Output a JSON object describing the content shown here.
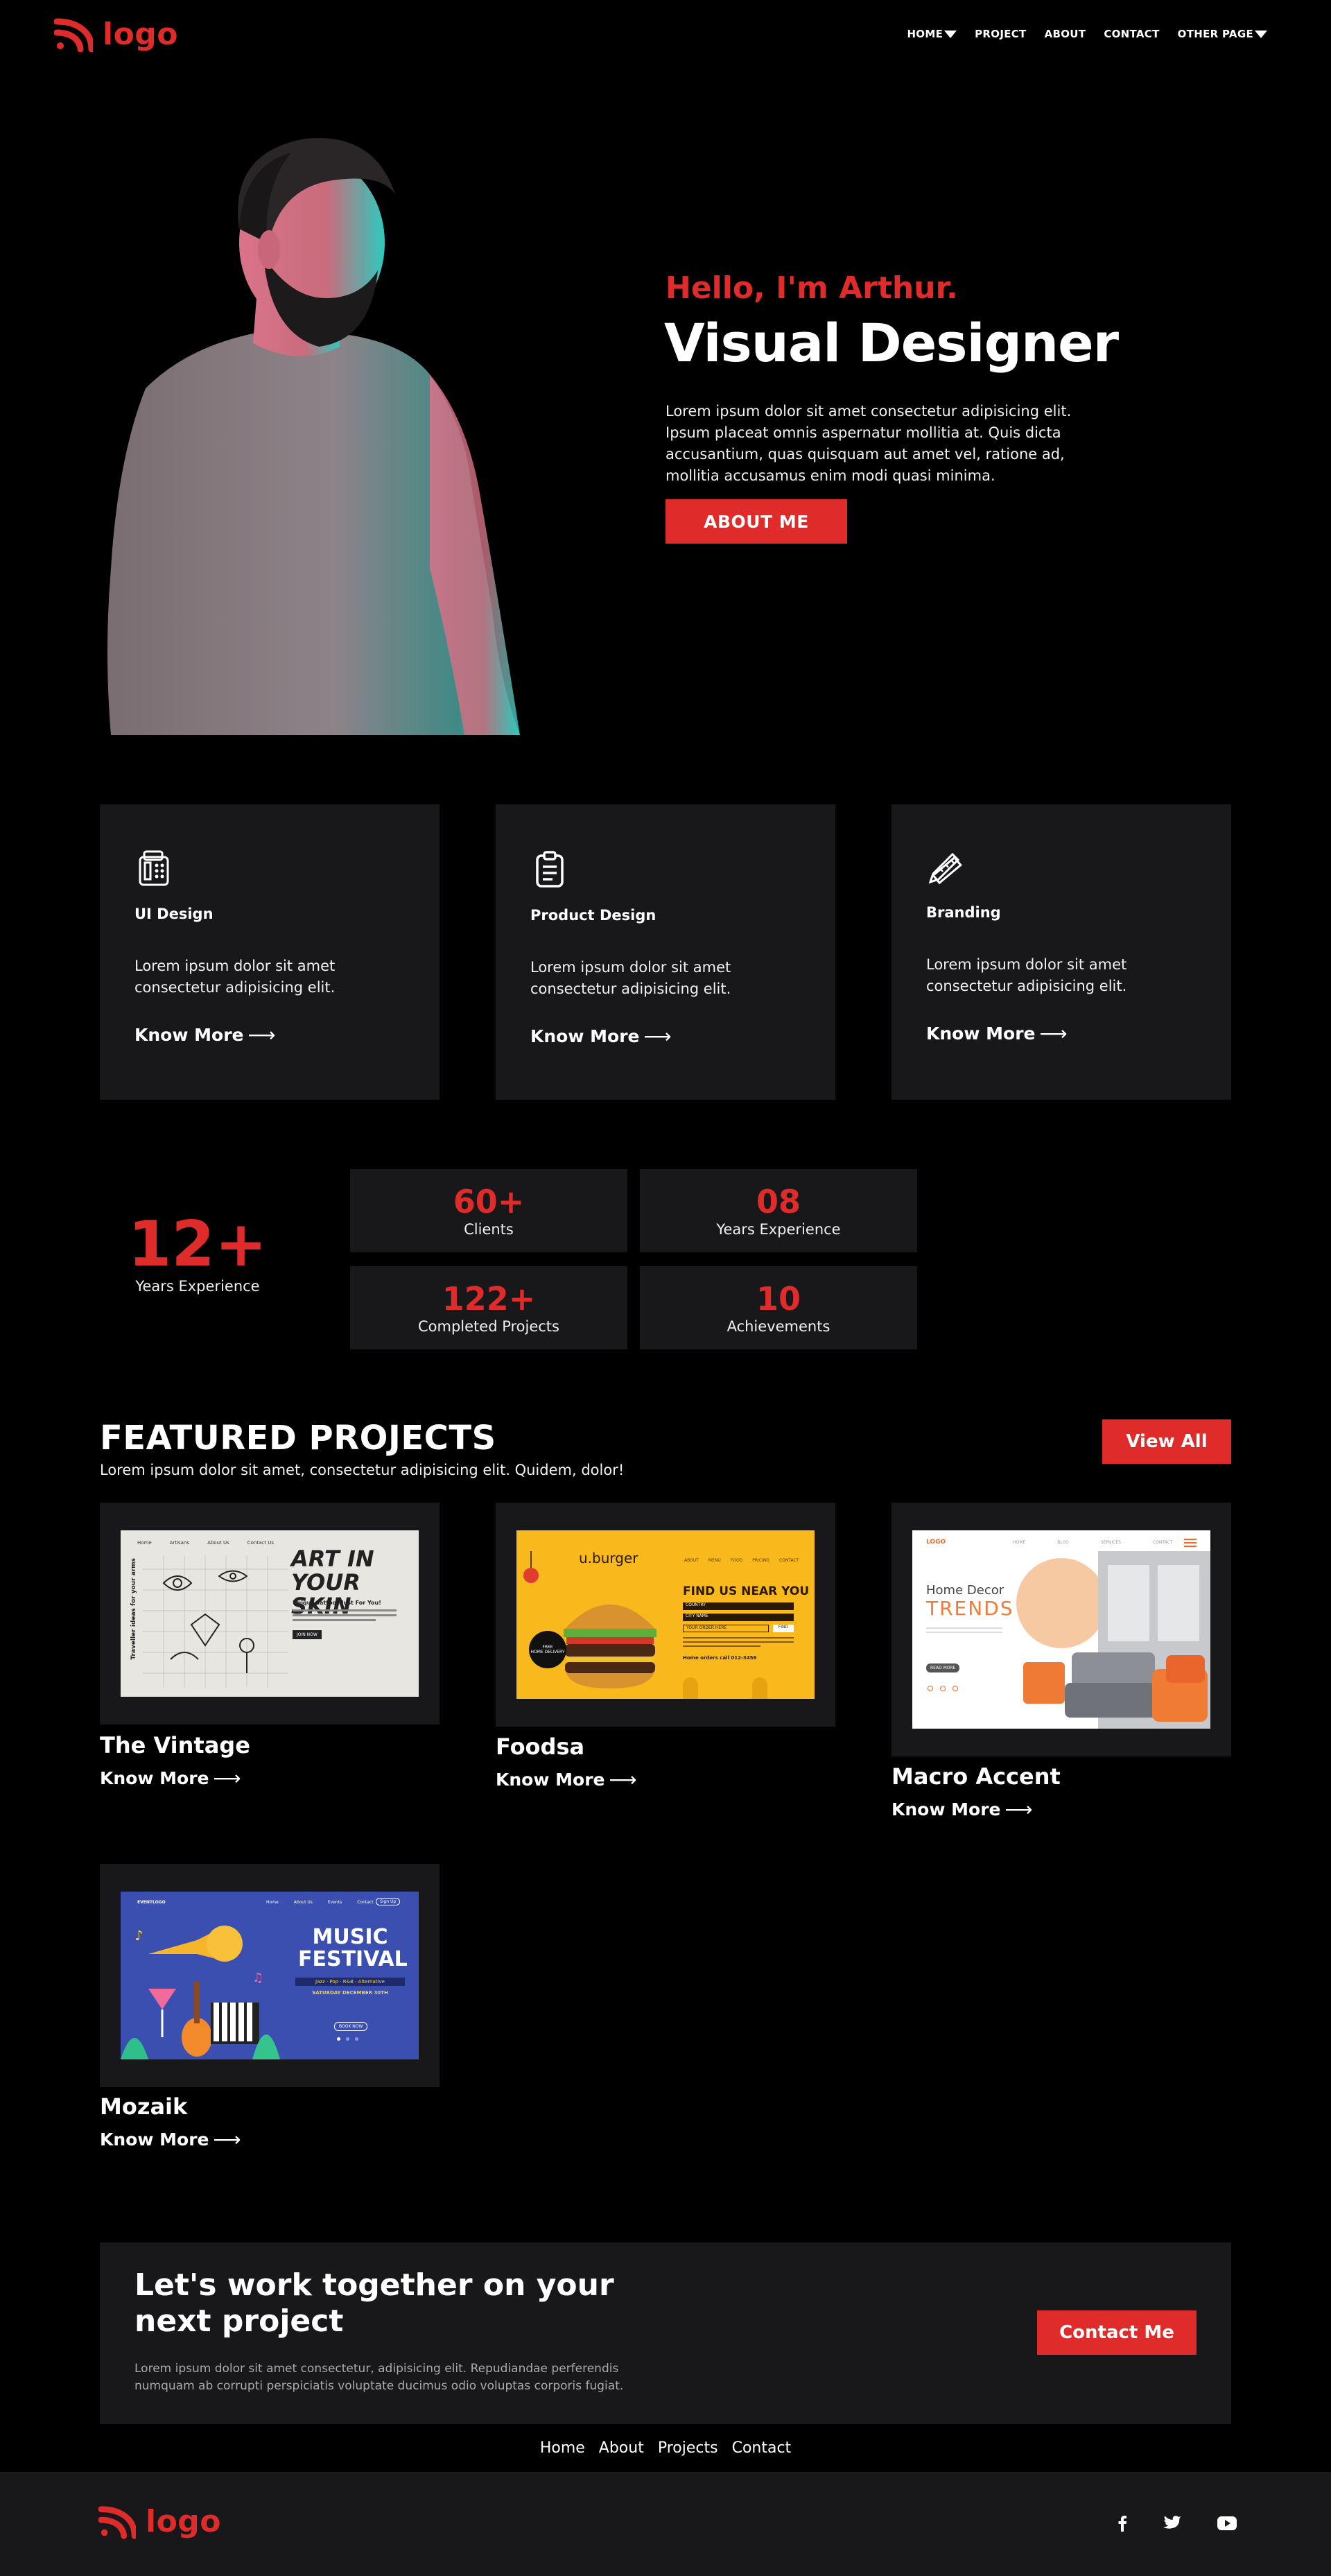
{
  "header": {
    "logo_text": "logo",
    "nav": [
      {
        "label": "HOME",
        "dropdown": true
      },
      {
        "label": "PROJECT",
        "dropdown": false
      },
      {
        "label": "ABOUT",
        "dropdown": false
      },
      {
        "label": "CONTACT",
        "dropdown": false
      },
      {
        "label": "OTHER PAGE",
        "dropdown": true
      }
    ]
  },
  "hero": {
    "greeting": "Hello, I'm Arthur.",
    "role": "Visual Designer",
    "description": "Lorem ipsum dolor sit amet consectetur adipisicing elit. Ipsum placeat omnis aspernatur mollitia at. Quis dicta accusantium, quas quisquam aut amet vel, ratione ad, mollitia accusamus enim modi quasi minima.",
    "button": "ABOUT ME"
  },
  "services": [
    {
      "icon": "calculator-icon",
      "title": "UI Design",
      "description": "Lorem ipsum dolor sit amet consectetur adipisicing elit.",
      "link": "Know More"
    },
    {
      "icon": "clipboard-icon",
      "title": "Product Design",
      "description": "Lorem ipsum dolor sit amet consectetur adipisicing elit.",
      "link": "Know More"
    },
    {
      "icon": "pencil-ruler-icon",
      "title": "Branding",
      "description": "Lorem ipsum dolor sit amet consectetur adipisicing elit.",
      "link": "Know More"
    }
  ],
  "stats": {
    "headline": {
      "value": "12+",
      "label": "Years Experience"
    },
    "items": [
      {
        "value": "60+",
        "label": "Clients"
      },
      {
        "value": "08",
        "label": "Years Experience"
      },
      {
        "value": "122+",
        "label": "Completed Projects"
      },
      {
        "value": "10",
        "label": "Achievements"
      }
    ]
  },
  "projects": {
    "title": "FEATURED PROJECTS",
    "subtitle": "Lorem ipsum dolor sit amet, consectetur adipisicing elit. Quidem, dolor!",
    "view_all": "View All",
    "items": [
      {
        "name": "The Vintage",
        "link": "Know More",
        "preview": {
          "nav": [
            "Home",
            "Artisans",
            "About Us",
            "Contact Us"
          ],
          "side": "Traveller ideas for your arms",
          "heading1": "ART IN",
          "heading2": "YOUR SKIN",
          "sub": "Unique Tattoos Just For You!",
          "btn": "JOIN NOW"
        }
      },
      {
        "name": "Foodsa",
        "link": "Know More",
        "preview": {
          "brand": "u.burger",
          "nav": [
            "ABOUT",
            "MENU",
            "FOOD",
            "PRICING",
            "CONTACT"
          ],
          "heading": "FIND US NEAR YOU",
          "select1": "COUNTRY",
          "select2": "CITY NAME",
          "field": "YOUR ORDER HERE",
          "go": "FIND",
          "badge1": "FREE",
          "badge2": "HOME DELIVERY",
          "note": "Home orders call 012-3456"
        }
      },
      {
        "name": "Macro Accent",
        "link": "Know More",
        "preview": {
          "logo": "LOGO",
          "nav": [
            "HOME",
            "BLOG",
            "SERVICES",
            "CONTACT"
          ],
          "line1": "Home Decor",
          "line2": "TRENDS",
          "btn": "READ MORE"
        }
      },
      {
        "name": "Mozaik",
        "link": "Know More",
        "preview": {
          "logo": "EVENTLOGO",
          "nav": [
            "Home",
            "About Us",
            "Events",
            "Contact"
          ],
          "signup": "Sign Up",
          "heading1": "MUSIC",
          "heading2": "FESTIVAL",
          "tags": "Jazz · Pop · R&B · Alternative",
          "date": "SATURDAY DECEMBER 30TH",
          "btn": "BOOK NOW"
        }
      }
    ]
  },
  "cta": {
    "title_line1": "Let's work together on your",
    "title_line2": "next project",
    "description": "Lorem ipsum dolor sit amet consectetur, adipisicing elit. Repudiandae perferendis numquam ab corrupti perspiciatis voluptate ducimus odio voluptas corporis fugiat.",
    "button": "Contact Me"
  },
  "footer_links": [
    "Home",
    "About",
    "Projects",
    "Contact"
  ],
  "footer": {
    "logo_text": "logo",
    "social": [
      "facebook-icon",
      "twitter-icon",
      "youtube-icon"
    ]
  },
  "colors": {
    "accent": "#e02b2b",
    "card": "#18181b",
    "background": "#000000"
  }
}
